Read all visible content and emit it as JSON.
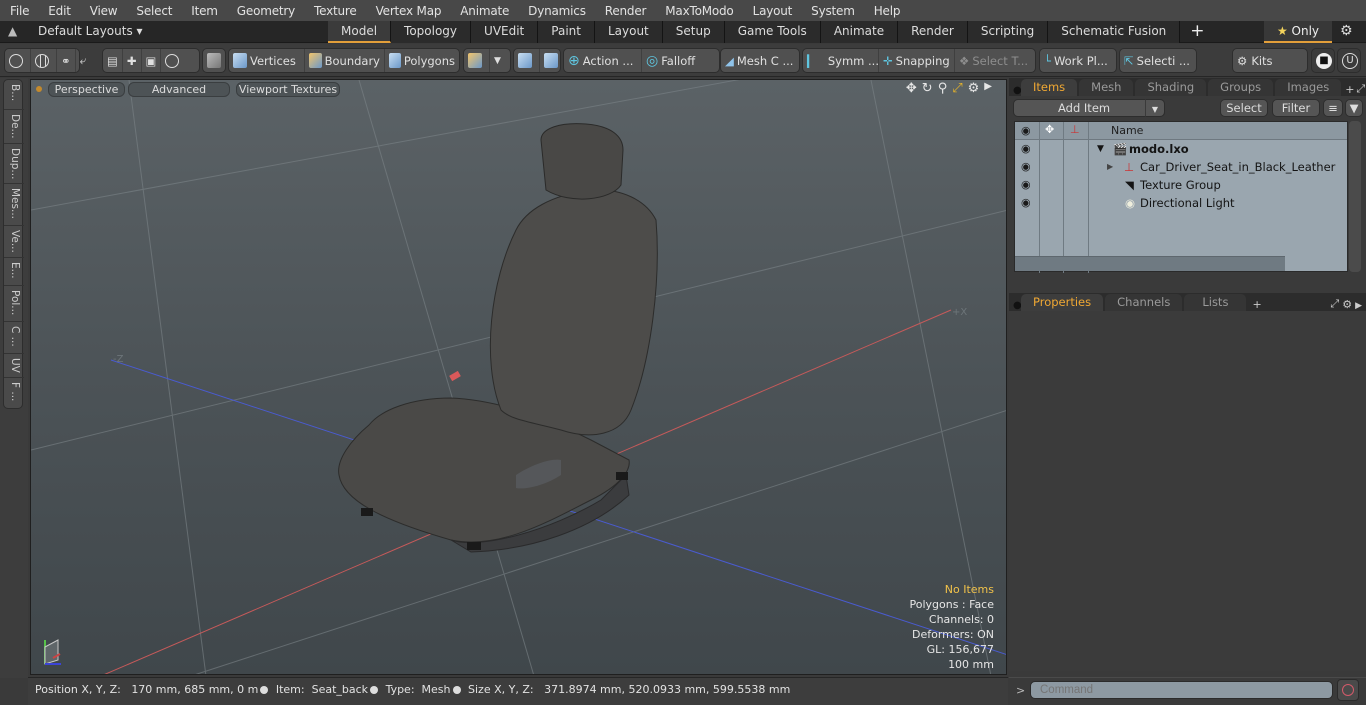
{
  "menubar": {
    "items": [
      "File",
      "Edit",
      "View",
      "Select",
      "Item",
      "Geometry",
      "Texture",
      "Vertex Map",
      "Animate",
      "Dynamics",
      "Render",
      "MaxToModo",
      "Layout",
      "System",
      "Help"
    ]
  },
  "layoutbar": {
    "layouts_label": "Default Layouts ▾",
    "tabs": [
      "Model",
      "Topology",
      "UVEdit",
      "Paint",
      "Layout",
      "Setup",
      "Game Tools",
      "Animate",
      "Render",
      "Scripting",
      "Schematic Fusion"
    ],
    "active_tab": "Model",
    "add_tab": "+",
    "only_label": "Only",
    "only_star": "★"
  },
  "toolbar": {
    "vertices": "Vertices",
    "boundary": "Boundary",
    "polygons": "Polygons",
    "action": "Action",
    "action_more": "...",
    "falloff": "Falloff",
    "mesh": "Mesh C ...",
    "symm": "Symm ...",
    "snapping": "Snapping",
    "select_t": "Select T...",
    "work_plane": "Work Pl...",
    "selecti": "Selecti ...",
    "kits": "Kits"
  },
  "left_tabs": [
    "B...",
    "De...",
    "Dup...",
    "Mes...",
    "Ve...",
    "E...",
    "Pol...",
    "C ...",
    "UV",
    "F ..."
  ],
  "viewport": {
    "view_mode": "Perspective",
    "shading": "Advanced",
    "textures": "Viewport Textures",
    "axis_minus_z": "-Z",
    "axis_plus_x": "+X",
    "overlay": {
      "selection": "No Items",
      "polygons": "Polygons : Face",
      "channels": "Channels: 0",
      "deformers": "Deformers: ON",
      "gl": "GL: 156,677",
      "scale": "100 mm"
    }
  },
  "items_panel": {
    "tabs": [
      "Items",
      "Mesh ...",
      "Shading",
      "Groups",
      "Images"
    ],
    "active_tab": "Items",
    "add_item": "Add Item",
    "select": "Select",
    "filter": "Filter",
    "column_name": "Name",
    "tree": [
      {
        "name": "modo.lxo",
        "level": 0,
        "icon": "scene-icon",
        "bold": true
      },
      {
        "name": "Car_Driver_Seat_in_Black_Leather",
        "level": 1,
        "icon": "mesh-locator-icon",
        "bold": false
      },
      {
        "name": "Texture Group",
        "level": 1,
        "icon": "texture-group-icon",
        "bold": false
      },
      {
        "name": "Directional Light",
        "level": 1,
        "icon": "light-icon",
        "bold": false
      }
    ]
  },
  "properties_panel": {
    "tabs": [
      "Properties",
      "Channels",
      "Lists"
    ],
    "active_tab": "Properties",
    "add_tab": "+"
  },
  "statusbar": {
    "position_label": "Position X, Y, Z:",
    "position_value": "170 mm, 685 mm, 0 m",
    "item_label": "Item:",
    "item_value": "Seat_back",
    "type_label": "Type:",
    "type_value": "Mesh",
    "size_label": "Size X, Y, Z:",
    "size_value": "371.8974 mm, 520.0933 mm, 599.5538 mm"
  },
  "command": {
    "prompt": ">",
    "placeholder": "Command"
  },
  "colors": {
    "accent": "#e39f3a",
    "overlay_highlight": "#f1c24a",
    "tree_bg": "#9aa6af"
  }
}
